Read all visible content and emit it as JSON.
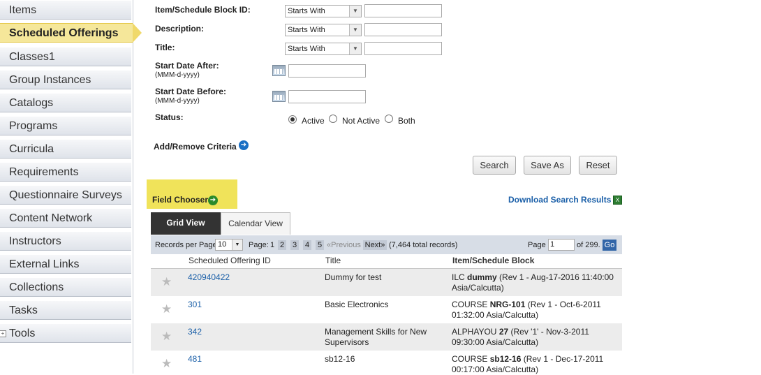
{
  "sidebar": {
    "items": [
      {
        "label": "Items"
      },
      {
        "label": "Scheduled Offerings"
      },
      {
        "label": "Classes1"
      },
      {
        "label": "Group Instances"
      },
      {
        "label": "Catalogs"
      },
      {
        "label": "Programs"
      },
      {
        "label": "Curricula"
      },
      {
        "label": "Requirements"
      },
      {
        "label": "Questionnaire Surveys"
      },
      {
        "label": "Content Network"
      },
      {
        "label": "Instructors"
      },
      {
        "label": "External Links"
      },
      {
        "label": "Collections"
      },
      {
        "label": "Tasks"
      },
      {
        "label": "Tools"
      }
    ],
    "active_index": 1
  },
  "form": {
    "item_block_id": {
      "label": "Item/Schedule Block ID:",
      "operator": "Starts With",
      "value": ""
    },
    "description": {
      "label": "Description:",
      "operator": "Starts With",
      "value": ""
    },
    "title": {
      "label": "Title:",
      "operator": "Starts With",
      "value": ""
    },
    "start_after": {
      "label": "Start Date After:",
      "format": "(MMM-d-yyyy)",
      "value": ""
    },
    "start_before": {
      "label": "Start Date Before:",
      "format": "(MMM-d-yyyy)",
      "value": ""
    },
    "status": {
      "label": "Status:",
      "options": [
        "Active",
        "Not Active",
        "Both"
      ],
      "selected": "Active"
    },
    "add_remove": "Add/Remove Criteria"
  },
  "buttons": {
    "search": "Search",
    "save_as": "Save As",
    "reset": "Reset"
  },
  "field_chooser": "Field Chooser",
  "download": "Download Search Results",
  "tabs": {
    "grid": "Grid View",
    "calendar": "Calendar View"
  },
  "pager": {
    "records_label": "Records per Page",
    "records_value": "10",
    "page_label": "Page:",
    "pages": [
      "1",
      "2",
      "3",
      "4",
      "5"
    ],
    "previous": "«Previous",
    "next": "Next»",
    "total": "(7,464 total records)",
    "page_input_label": "Page",
    "page_input_value": "1",
    "of_pages": "of 299.",
    "go": "Go"
  },
  "table": {
    "headers": [
      "Scheduled Offering ID",
      "Title",
      "Item/Schedule Block"
    ],
    "rows": [
      {
        "id": "420940422",
        "title": "Dummy for test",
        "block_pre": "ILC ",
        "block_bold": "dummy",
        "block_post": " (Rev 1 - Aug-17-2016 11:40:00",
        "block_line2": "Asia/Calcutta)",
        "title2": ""
      },
      {
        "id": "301",
        "title": "Basic Electronics",
        "block_pre": "COURSE ",
        "block_bold": "NRG-101",
        "block_post": " (Rev 1 - Oct-6-2011",
        "block_line2": "01:32:00 Asia/Calcutta)",
        "title2": ""
      },
      {
        "id": "342",
        "title": "Management Skills for New",
        "title2": "Supervisors",
        "block_pre": "ALPHAYOU ",
        "block_bold": "27",
        "block_post": " (Rev '1' - Nov-3-2011",
        "block_line2": "09:30:00 Asia/Calcutta)"
      },
      {
        "id": "481",
        "title": "sb12-16",
        "title2": "",
        "block_pre": "COURSE ",
        "block_bold": "sb12-16",
        "block_post": " (Rev 1 - Dec-17-2011",
        "block_line2": "00:17:00 Asia/Calcutta)"
      }
    ]
  }
}
